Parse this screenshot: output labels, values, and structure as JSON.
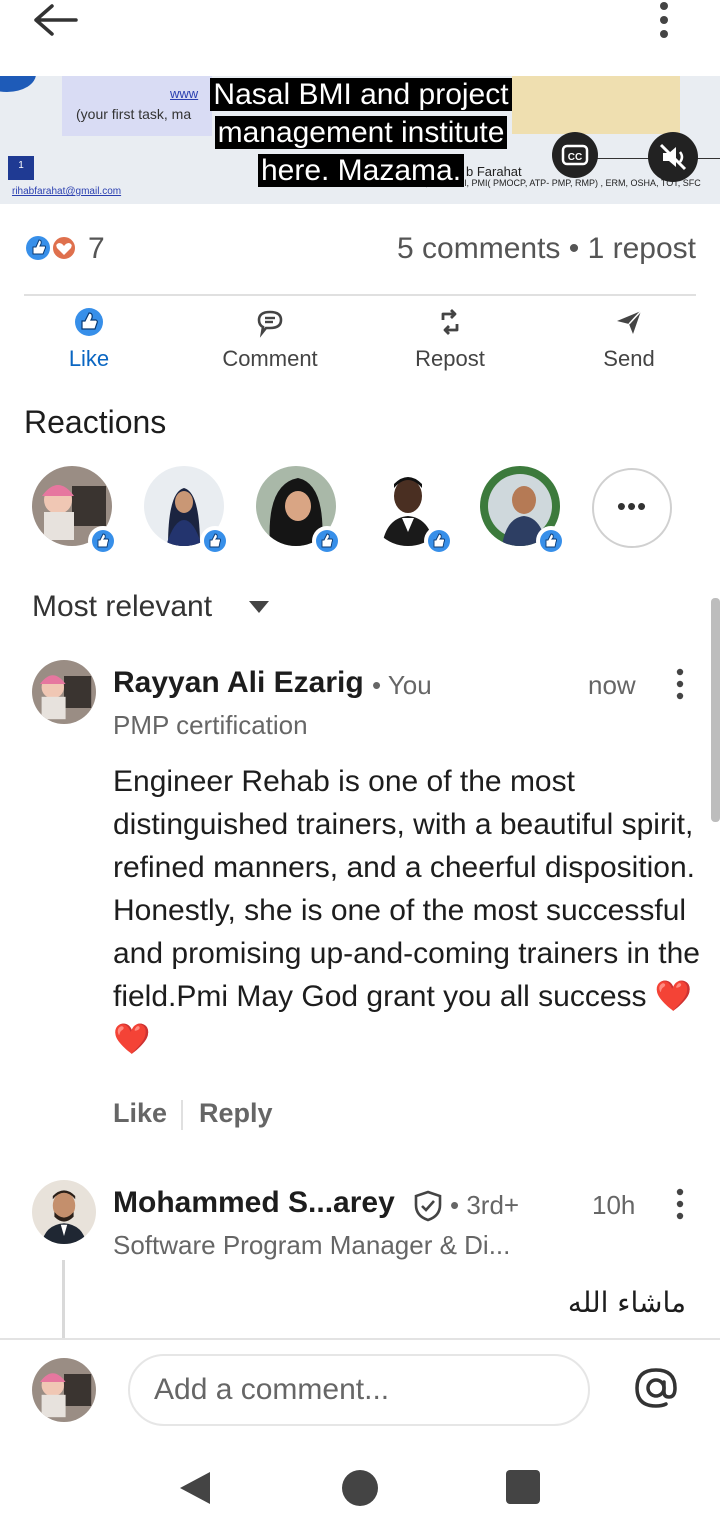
{
  "video": {
    "slide_text": {
      "www": "www",
      "task": "(your first task, ma",
      "page_num": "1",
      "email": "rihabfarahat@gmail.com",
      "name_fragment": "b Farahat",
      "credentials": "MBA, BSc Civil, PMI( PMOCP, ATP- PMP, RMP) , ERM, OSHA, TOT, SFC"
    },
    "caption_lines": [
      "Nasal BMI and project",
      "management institute",
      "here. Mazama."
    ],
    "cc_label": "CC"
  },
  "stats": {
    "reaction_count": "7",
    "comments_reposts": "5 comments • 1 repost"
  },
  "actions": [
    {
      "label": "Like",
      "icon": "thumbs-up-icon"
    },
    {
      "label": "Comment",
      "icon": "comment-icon"
    },
    {
      "label": "Repost",
      "icon": "repost-icon"
    },
    {
      "label": "Send",
      "icon": "send-icon"
    }
  ],
  "reactions": {
    "title": "Reactions",
    "more_label": "•••"
  },
  "sort": {
    "label": "Most relevant"
  },
  "comments": [
    {
      "author": "Rayyan Ali Ezarig",
      "relation": "• You",
      "headline": "PMP certification",
      "time": "now",
      "body": "Engineer Rehab is one of the most distinguished trainers, with a beautiful spirit, refined manners, and a cheerful disposition. Honestly, she is one of the most successful and promising up-and-coming trainers in the field.Pmi May God grant you all success",
      "hearts": "❤️❤️",
      "like_label": "Like",
      "reply_label": "Reply"
    },
    {
      "author": "Mohammed S...arey",
      "relation": "• 3rd+",
      "headline": "Software Program Manager & Di...",
      "time": "10h",
      "body": "ماشاء الله"
    }
  ],
  "composer": {
    "placeholder": "Add a comment..."
  },
  "colors": {
    "accent": "#0a66c2",
    "text": "#1d1d1d",
    "muted": "#666666"
  }
}
